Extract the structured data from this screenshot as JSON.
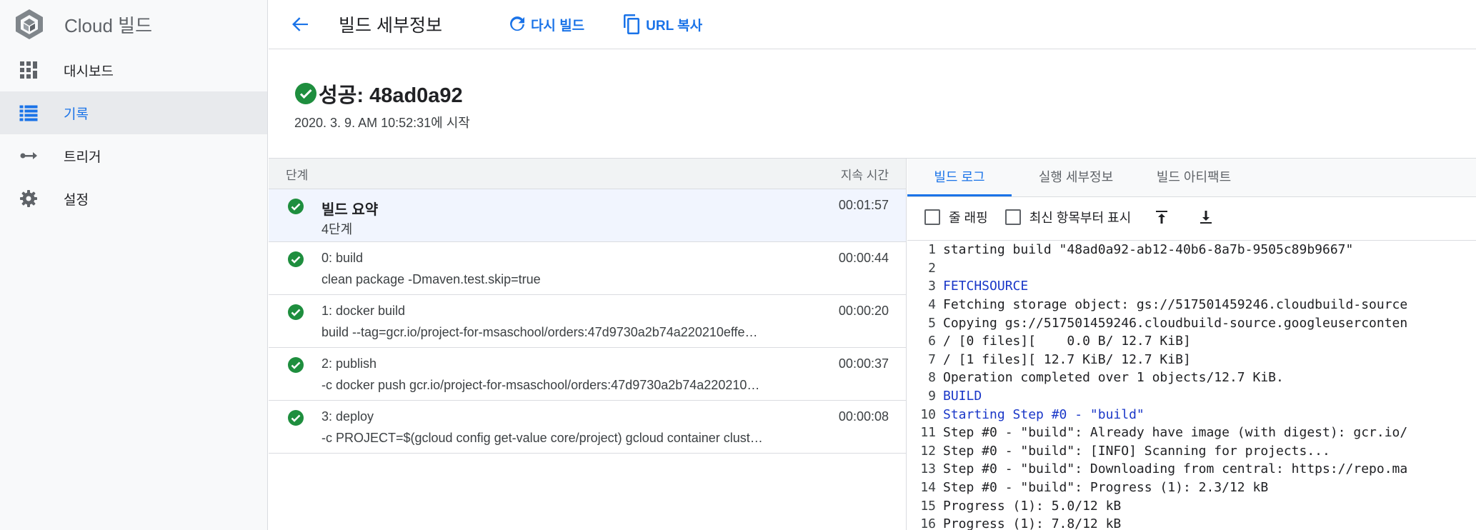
{
  "sidebar": {
    "brand_title": "Cloud 빌드",
    "items": [
      {
        "label": "대시보드",
        "icon": "dashboard-icon",
        "active": false
      },
      {
        "label": "기록",
        "icon": "list-icon",
        "active": true
      },
      {
        "label": "트리거",
        "icon": "trigger-icon",
        "active": false
      },
      {
        "label": "설정",
        "icon": "gear-icon",
        "active": false
      }
    ]
  },
  "header": {
    "title": "빌드 세부정보",
    "rebuild_label": "다시 빌드",
    "copy_url_label": "URL 복사"
  },
  "status": {
    "title": "성공: 48ad0a92",
    "started": "2020. 3. 9. AM 10:52:31에 시작"
  },
  "steps": {
    "col_step": "단계",
    "col_duration": "지속 시간",
    "rows": [
      {
        "name": "빌드 요약",
        "desc": "4단계",
        "duration": "00:01:57"
      },
      {
        "name": "0: build",
        "desc": "clean package -Dmaven.test.skip=true",
        "duration": "00:00:44"
      },
      {
        "name": "1: docker build",
        "desc": "build --tag=gcr.io/project-for-msaschool/orders:47d9730a2b74a220210effe…",
        "duration": "00:00:20"
      },
      {
        "name": "2: publish",
        "desc": "-c docker push gcr.io/project-for-msaschool/orders:47d9730a2b74a220210…",
        "duration": "00:00:37"
      },
      {
        "name": "3: deploy",
        "desc": "-c PROJECT=$(gcloud config get-value core/project) gcloud container clust…",
        "duration": "00:00:08"
      }
    ]
  },
  "logs": {
    "tabs": [
      "빌드 로그",
      "실행 세부정보",
      "빌드 아티팩트"
    ],
    "wrap_label": "줄 래핑",
    "newest_first_label": "최신 항목부터 표시",
    "lines": [
      {
        "n": "1",
        "text": "starting build \"48ad0a92-ab12-40b6-8a7b-9505c89b9667\""
      },
      {
        "n": "2",
        "text": ""
      },
      {
        "n": "3",
        "text": "FETCHSOURCE"
      },
      {
        "n": "4",
        "text": "Fetching storage object: gs://517501459246.cloudbuild-source"
      },
      {
        "n": "5",
        "text": "Copying gs://517501459246.cloudbuild-source.googleuserconten"
      },
      {
        "n": "6",
        "text": "/ [0 files][    0.0 B/ 12.7 KiB]"
      },
      {
        "n": "7",
        "text": "/ [1 files][ 12.7 KiB/ 12.7 KiB]"
      },
      {
        "n": "8",
        "text": "Operation completed over 1 objects/12.7 KiB."
      },
      {
        "n": "9",
        "text": "BUILD"
      },
      {
        "n": "10",
        "text": "Starting Step #0 - \"build\""
      },
      {
        "n": "11",
        "text": "Step #0 - \"build\": Already have image (with digest): gcr.io/"
      },
      {
        "n": "12",
        "text": "Step #0 - \"build\": [INFO] Scanning for projects..."
      },
      {
        "n": "13",
        "text": "Step #0 - \"build\": Downloading from central: https://repo.ma"
      },
      {
        "n": "14",
        "text": "Step #0 - \"build\": Progress (1): 2.3/12 kB"
      },
      {
        "n": "15",
        "text": "Progress (1): 5.0/12 kB"
      },
      {
        "n": "16",
        "text": "Progress (1): 7.8/12 kB"
      }
    ]
  },
  "colors": {
    "accent": "#1a73e8",
    "success": "#1e8e3e",
    "log_highlight": "#1a37c8"
  }
}
